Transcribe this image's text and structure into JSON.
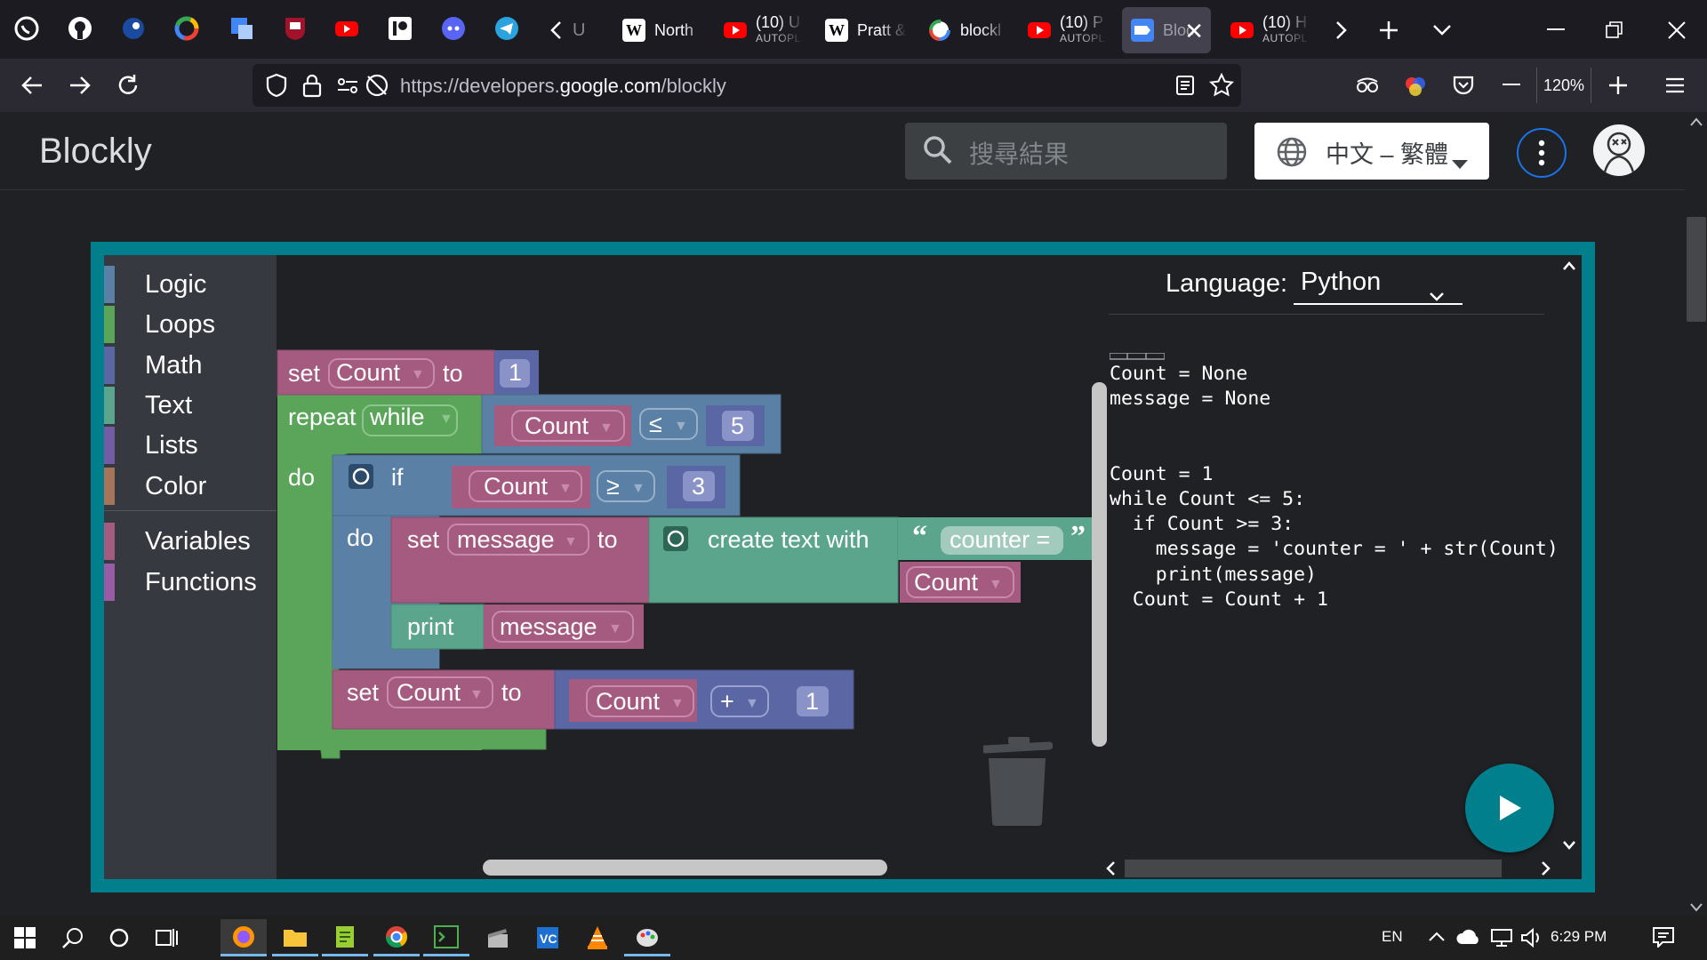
{
  "browser": {
    "tabs": [
      {
        "icon": "scroll-left-tab-icon",
        "title": "U",
        "sub": ""
      },
      {
        "icon": "wikipedia-icon",
        "title": "North",
        "sub": ""
      },
      {
        "icon": "youtube-icon",
        "title": "(10) U",
        "sub": "AUTOPL"
      },
      {
        "icon": "wikipedia-icon",
        "title": "Pratt &",
        "sub": ""
      },
      {
        "icon": "google-icon",
        "title": "blockl",
        "sub": ""
      },
      {
        "icon": "youtube-icon",
        "title": "(10) P",
        "sub": "AUTOPL"
      },
      {
        "icon": "blockly-icon",
        "title": "Bloc",
        "sub": "",
        "active": true
      },
      {
        "icon": "youtube-icon",
        "title": "(10) H",
        "sub": "AUTOPL"
      }
    ],
    "url_prefix": "https://developers.",
    "url_domain": "google.com",
    "url_path": "/blockly",
    "zoom": "120%"
  },
  "site": {
    "brand": "Blockly",
    "search_placeholder": "搜尋結果",
    "language": "中文 – 繁體"
  },
  "toolbox": {
    "categories": [
      {
        "label": "Logic",
        "color": "#5b80a5"
      },
      {
        "label": "Loops",
        "color": "#5ba55b"
      },
      {
        "label": "Math",
        "color": "#5b67a5"
      },
      {
        "label": "Text",
        "color": "#5ba58c"
      },
      {
        "label": "Lists",
        "color": "#745ba5"
      },
      {
        "label": "Color",
        "color": "#a5745b"
      },
      {
        "label": "Variables",
        "color": "#a55b80"
      },
      {
        "label": "Functions",
        "color": "#995ba5"
      }
    ]
  },
  "blocks": {
    "set1": {
      "kw": "set",
      "var": "Count",
      "to": "to",
      "num": "1"
    },
    "repeat": {
      "kw": "repeat",
      "mode": "while",
      "do": "do",
      "var": "Count",
      "op": "≤",
      "num": "5"
    },
    "if": {
      "kw": "if",
      "do": "do",
      "var": "Count",
      "op": "≥",
      "num": "3"
    },
    "setmsg": {
      "kw": "set",
      "var": "message",
      "to": "to",
      "create": "create text with",
      "text": "counter =",
      "var2": "Count"
    },
    "print": {
      "kw": "print",
      "var": "message"
    },
    "set2": {
      "kw": "set",
      "var": "Count",
      "to": "to",
      "var2": "Count",
      "op": "+",
      "num": "1"
    }
  },
  "codepanel": {
    "label": "Language:",
    "language": "Python",
    "code": "Count = None\nmessage = None\n\n\nCount = 1\nwhile Count <= 5:\n  if Count >= 3:\n    message = 'counter = ' + str(Count)\n    print(message)\n  Count = Count + 1"
  },
  "taskbar": {
    "lang": "EN",
    "time": "6:29 PM"
  }
}
